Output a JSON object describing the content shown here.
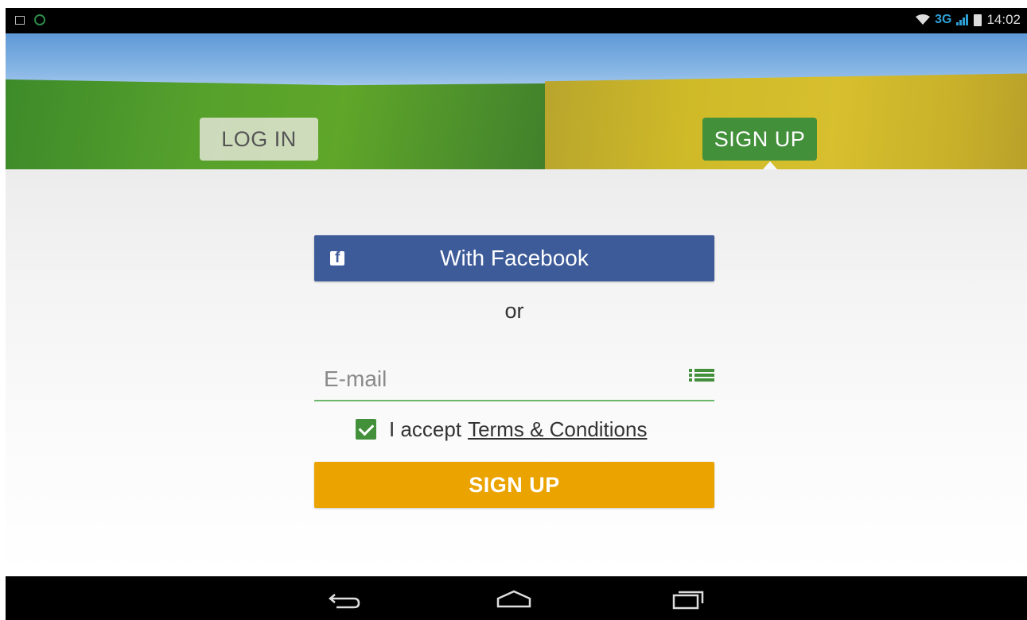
{
  "status_bar": {
    "left_icons": [
      "gallery-icon",
      "app-notification-icon"
    ],
    "network": "3G",
    "time": "14:02"
  },
  "header": {
    "tabs": [
      {
        "label": "LOG IN",
        "selected": false
      },
      {
        "label": "SIGN UP",
        "selected": true
      }
    ]
  },
  "main": {
    "facebook_button": {
      "label": "With Facebook",
      "icon": "facebook-icon",
      "color": "#3d5b99"
    },
    "or_text": "or",
    "email": {
      "placeholder": "E-mail",
      "value": ""
    },
    "terms": {
      "checked": true,
      "prefix": "I accept",
      "link_label": "Terms & Conditions"
    },
    "signup_button": {
      "label": "SIGN UP",
      "color": "#eba300"
    }
  },
  "colors": {
    "accent_green": "#43903b",
    "facebook_blue": "#3d5b99",
    "signup_orange": "#eba300"
  },
  "nav_bar": {
    "buttons": [
      "back-icon",
      "home-icon",
      "recents-icon"
    ]
  }
}
